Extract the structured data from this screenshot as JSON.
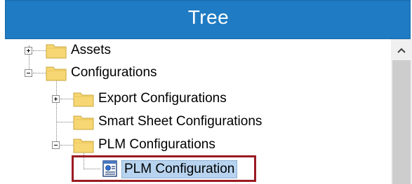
{
  "title": "Tree",
  "nodes": {
    "assets": "Assets",
    "configurations": "Configurations",
    "export_configurations": "Export Configurations",
    "smart_sheet_configurations": "Smart Sheet Configurations",
    "plm_configurations": "PLM Configurations",
    "plm_configuration": "PLM Configuration"
  },
  "icons": {
    "folder": "folder-icon",
    "document": "plm-document-icon",
    "expand": "plus-expander",
    "collapse": "minus-expander",
    "scroll_up": "chevron-up-icon"
  },
  "colors": {
    "title_bar": "#1f7bc3",
    "selection": "#b7d3ef",
    "highlight_border": "#9a1b22",
    "folder_fill": "#f7d774"
  }
}
